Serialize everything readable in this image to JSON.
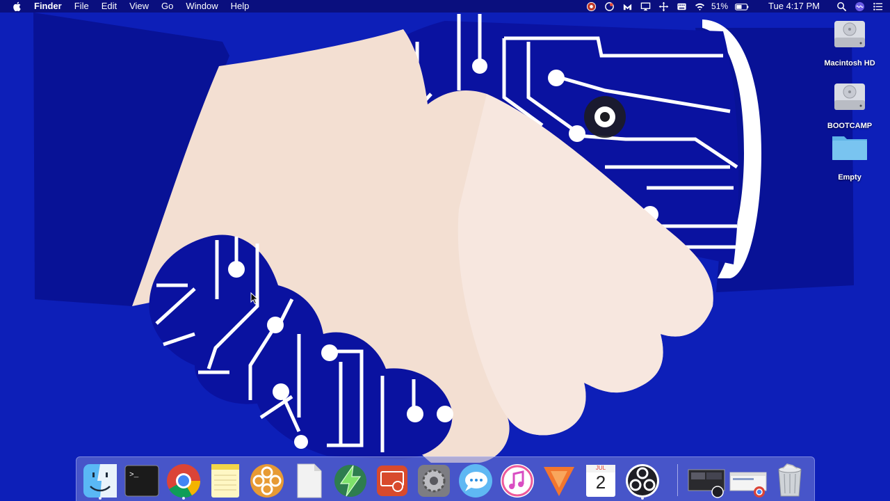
{
  "menubar": {
    "app_name": "Finder",
    "menus": [
      "File",
      "Edit",
      "View",
      "Go",
      "Window",
      "Help"
    ],
    "battery_percent": "51%",
    "clock": "Tue 4:17 PM"
  },
  "desktop_icons": [
    {
      "label": "Macintosh HD",
      "icon": "hard-drive-icon"
    },
    {
      "label": "BOOTCAMP",
      "icon": "hard-drive-icon"
    },
    {
      "label": "Empty",
      "icon": "folder-icon"
    }
  ],
  "dock": {
    "calendar_month": "JUL",
    "calendar_day": "2",
    "apps": [
      "finder",
      "terminal",
      "chrome",
      "notes",
      "plex",
      "textedit",
      "zap",
      "screen-sharing",
      "system-preferences",
      "messages",
      "itunes",
      "vectorworks",
      "calendar",
      "obs",
      "screenshot-window",
      "chrome-window",
      "trash"
    ]
  },
  "colors": {
    "wallpaper": "#0d1fb8",
    "hand_skin": "#f3dfd2",
    "circuit_blue": "#0a12a0",
    "menubar": "#0a0e78"
  }
}
